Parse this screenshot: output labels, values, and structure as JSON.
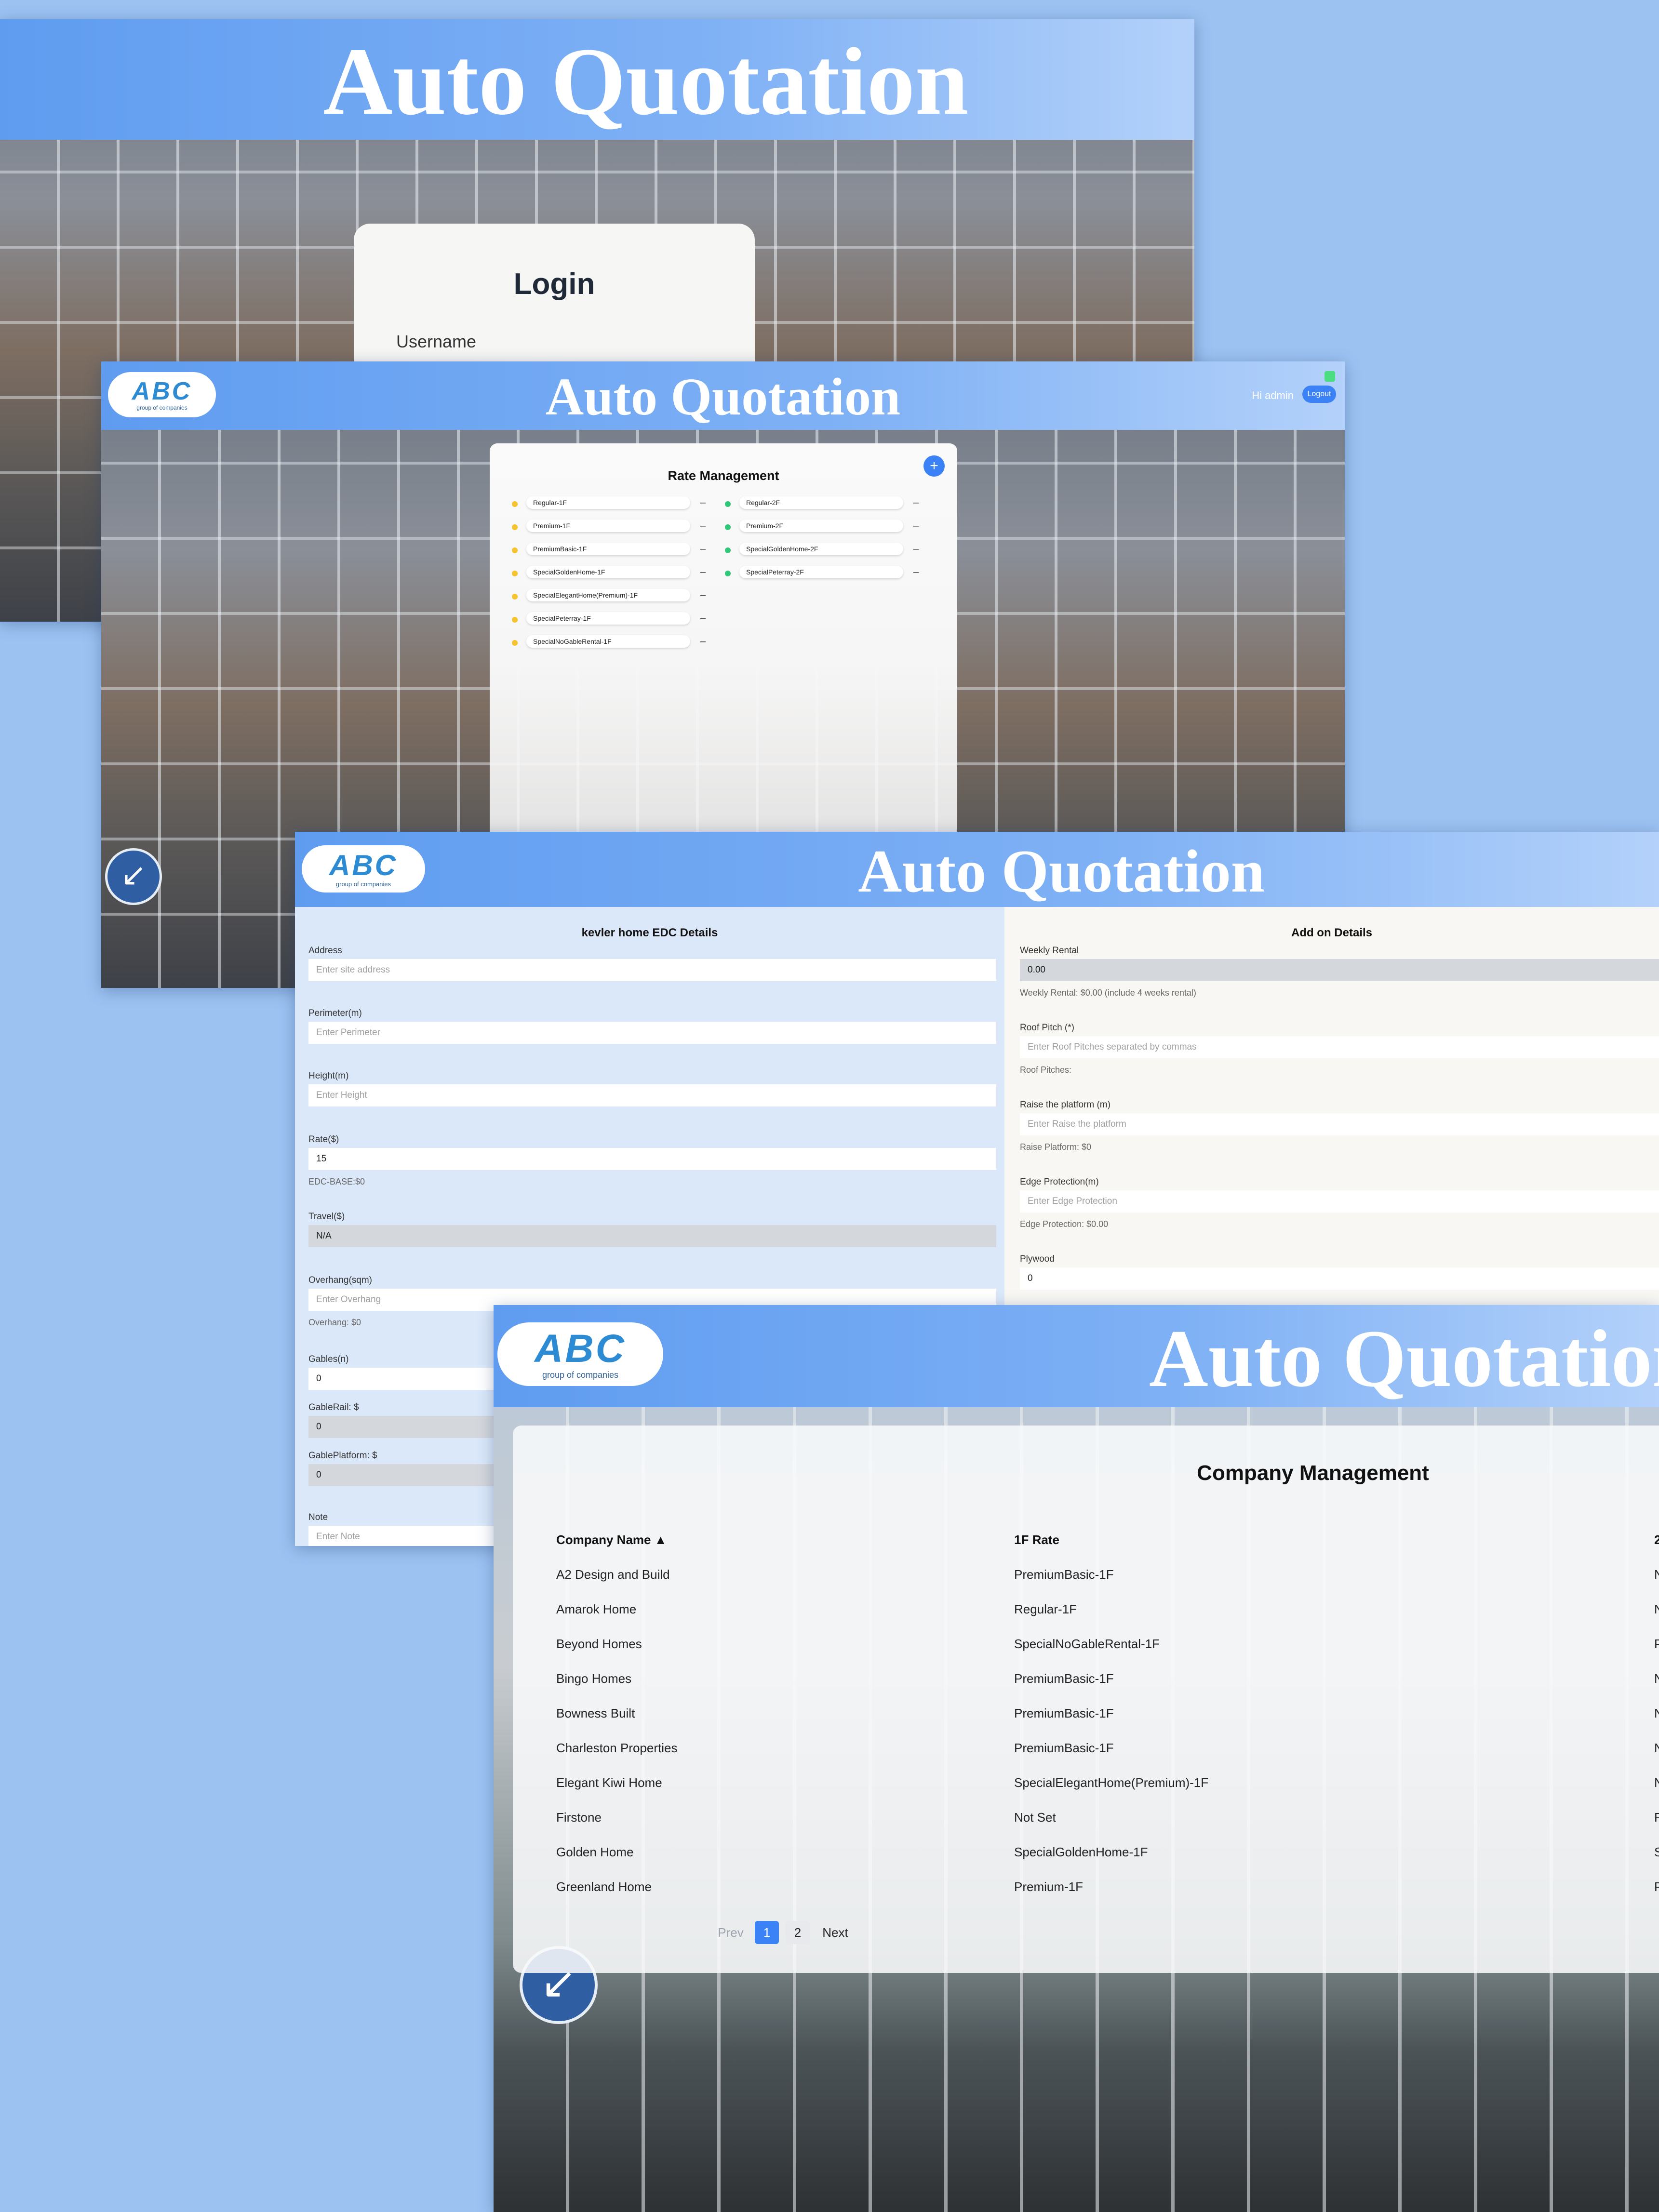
{
  "login_screen": {
    "title": "Auto Quotation",
    "card_heading": "Login",
    "username_label": "Username"
  },
  "rate_screen": {
    "title": "Auto Quotation",
    "logo_text": "ABC",
    "logo_subtext": "group of companies",
    "greeting": "Hi admin",
    "logout_label": "Logout",
    "heading": "Rate Management",
    "add_label": "+",
    "rates_1f": [
      "Regular-1F",
      "Premium-1F",
      "PremiumBasic-1F",
      "SpecialGoldenHome-1F",
      "SpecialElegantHome(Premium)-1F",
      "SpecialPeterray-1F",
      "SpecialNoGableRental-1F"
    ],
    "rates_2f": [
      "Regular-2F",
      "Premium-2F",
      "SpecialGoldenHome-2F",
      "SpecialPeterray-2F"
    ],
    "dash": "–",
    "colors": {
      "dot_1f": "#f4c430",
      "dot_2f": "#34c77b"
    }
  },
  "edc_screen": {
    "title": "Auto Quotation",
    "logo_text": "ABC",
    "logo_subtext": "group of companies",
    "left_heading": "kevler home EDC Details",
    "right_heading": "Add on Details",
    "address_label": "Address",
    "address_placeholder": "Enter site address",
    "perimeter_label": "Perimeter(m)",
    "perimeter_placeholder": "Enter Perimeter",
    "height_label": "Height(m)",
    "height_placeholder": "Enter Height",
    "rate_label": "Rate($)",
    "rate_value": "15",
    "rate_help": "EDC-BASE:$0",
    "travel_label": "Travel($)",
    "travel_value": "N/A",
    "overhang_label": "Overhang(sqm)",
    "overhang_placeholder": "Enter Overhang",
    "overhang_help": "Overhang: $0",
    "gables_label": "Gables(n)",
    "gables_value": "0",
    "gablerail_label": "GableRail: $",
    "gablerail_value": "0",
    "gableplatform_label": "GablePlatform: $",
    "gableplatform_value": "0",
    "note_label": "Note",
    "note_placeholder": "Enter Note",
    "weekly_label": "Weekly Rental",
    "weekly_value": "0.00",
    "weekly_help": "Weekly Rental: $0.00 (include 4 weeks rental)",
    "roof_label": "Roof Pitch   (*)",
    "roof_placeholder": "Enter Roof Pitches separated by commas",
    "roof_help": "Roof Pitches:",
    "raise_label": "Raise the platform (m)",
    "raise_placeholder": "Enter Raise the platform",
    "raise_help": "Raise Platform: $0",
    "edge_label": "Edge Protection(m)",
    "edge_placeholder": "Enter Edge Protection",
    "edge_help": "Edge Protection: $0.00",
    "plywood_label": "Plywood",
    "plywood_value": "0"
  },
  "company_screen": {
    "title": "Auto Quotation",
    "logo_text": "ABC",
    "logo_subtext": "group of companies",
    "heading": "Company Management",
    "columns": [
      "Company Name ▲",
      "1F Rate",
      "2"
    ],
    "rows": [
      {
        "name": "A2 Design and Build",
        "rate1f": "PremiumBasic-1F",
        "rate2f": "N"
      },
      {
        "name": "Amarok Home",
        "rate1f": "Regular-1F",
        "rate2f": "N"
      },
      {
        "name": "Beyond Homes",
        "rate1f": "SpecialNoGableRental-1F",
        "rate2f": "P"
      },
      {
        "name": "Bingo Homes",
        "rate1f": "PremiumBasic-1F",
        "rate2f": "N"
      },
      {
        "name": "Bowness Built",
        "rate1f": "PremiumBasic-1F",
        "rate2f": "N"
      },
      {
        "name": "Charleston Properties",
        "rate1f": "PremiumBasic-1F",
        "rate2f": "N"
      },
      {
        "name": "Elegant Kiwi Home",
        "rate1f": "SpecialElegantHome(Premium)-1F",
        "rate2f": "N"
      },
      {
        "name": "Firstone",
        "rate1f": "Not Set",
        "rate2f": "P"
      },
      {
        "name": "Golden Home",
        "rate1f": "SpecialGoldenHome-1F",
        "rate2f": "S"
      },
      {
        "name": "Greenland Home",
        "rate1f": "Premium-1F",
        "rate2f": "P"
      }
    ],
    "pager": {
      "prev": "Prev",
      "page1": "1",
      "page2": "2",
      "next": "Next"
    },
    "colors": {
      "accent": "#3b82f6"
    }
  }
}
